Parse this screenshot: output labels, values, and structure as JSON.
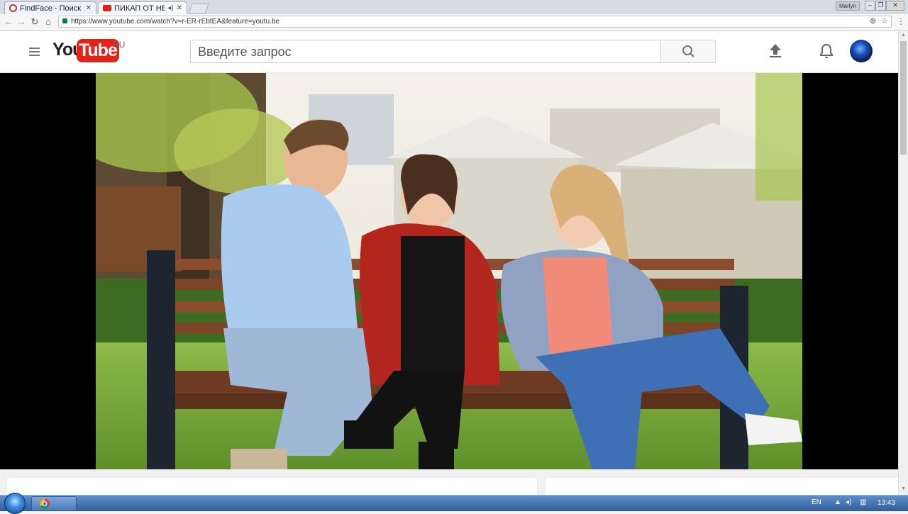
{
  "browser": {
    "tabs": [
      {
        "title": "FindFace - Поиск",
        "favicon_color": "#c0392b"
      },
      {
        "title": "ПИКАП ОТ НЕУВ",
        "favicon_color": "#e62117",
        "audio_icon": "speaker-icon"
      }
    ],
    "window_user": "Marlyn",
    "url": "https://www.youtube.com/watch?v=r-ER-rEbtEA&feature=youtu.be"
  },
  "youtube": {
    "logo_you": "You",
    "logo_tube": "Tube",
    "region": "RU",
    "search_placeholder": "Введите запрос",
    "brand_color": "#e62117"
  },
  "taskbar": {
    "language": "EN",
    "time": "13:43"
  }
}
